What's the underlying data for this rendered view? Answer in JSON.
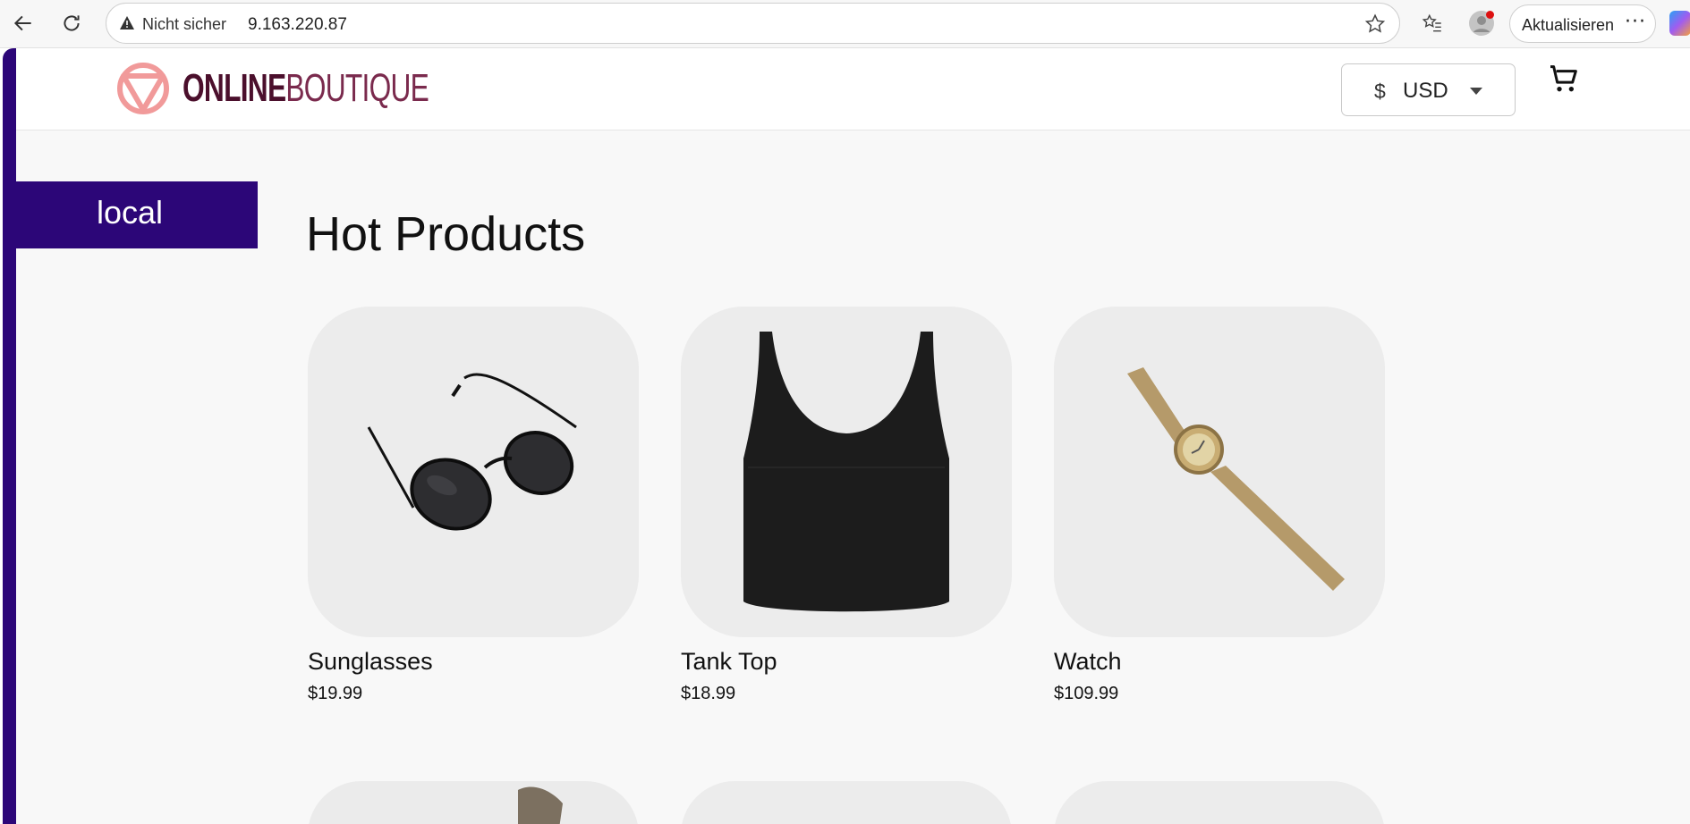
{
  "browser": {
    "security_label": "Nicht sicher",
    "url": "9.163.220.87",
    "update_label": "Aktualisieren",
    "more_label": "···"
  },
  "header": {
    "logo_bold": "ONLINE",
    "logo_light": "BOUTIQUE",
    "currency_symbol": "$",
    "currency_value": "USD"
  },
  "env_badge": {
    "label": "local"
  },
  "section": {
    "title": "Hot Products"
  },
  "products": [
    {
      "name": "Sunglasses",
      "price": "$19.99"
    },
    {
      "name": "Tank Top",
      "price": "$18.99"
    },
    {
      "name": "Watch",
      "price": "$109.99"
    }
  ],
  "colors": {
    "brand_purple": "#2c0678",
    "logo_pink": "#f19a9a",
    "logo_dark": "#4b0f2c"
  }
}
